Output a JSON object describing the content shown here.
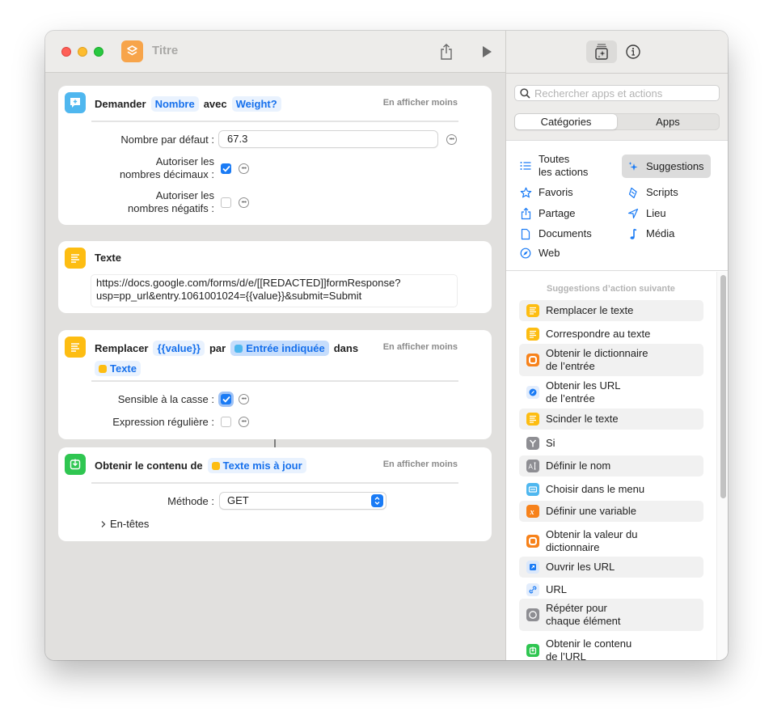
{
  "window": {
    "title": "Titre",
    "toolbar": {
      "share_icon": "share-icon",
      "run_icon": "play-icon",
      "library_icon": "action-library-icon",
      "info_icon": "info-icon"
    }
  },
  "actions": [
    {
      "id": "ask",
      "icon": "ask-input-icon",
      "color": "#4fb7ef",
      "head": {
        "verb": "Demander",
        "type_token": "Nombre",
        "joiner": "avec",
        "prompt_token": "Weight?"
      },
      "show_less": "En afficher moins",
      "fields": {
        "default_label": "Nombre par défaut :",
        "default_value": "67.3",
        "decimals_label_1": "Autoriser les",
        "decimals_label_2": "nombres décimaux :",
        "decimals_checked": true,
        "negatives_label_1": "Autoriser les",
        "negatives_label_2": "nombres négatifs :",
        "negatives_checked": false
      }
    },
    {
      "id": "text",
      "icon": "text-icon",
      "color": "#fdbd12",
      "head": {
        "verb": "Texte"
      },
      "content_line1": "https://docs.google.com/forms/d/e/[[REDACTED]]formResponse?",
      "content_line2": "usp=pp_url&entry.1061001024={{value}}&submit=Submit"
    },
    {
      "id": "replace",
      "icon": "replace-text-icon",
      "color": "#fdbd12",
      "head": {
        "verb": "Remplacer",
        "find_token": "{{value}}",
        "joiner1": "par",
        "replace_token": "Entrée indiquée",
        "joiner2": "dans",
        "target_token": "Texte"
      },
      "show_less": "En afficher moins",
      "fields": {
        "case_label": "Sensible à la casse :",
        "case_checked": true,
        "regex_label": "Expression régulière :",
        "regex_checked": false
      }
    },
    {
      "id": "get-contents",
      "icon": "download-icon",
      "color": "#2fc651",
      "head": {
        "verb": "Obtenir le contenu de",
        "url_token": "Texte mis à jour"
      },
      "show_less": "En afficher moins",
      "fields": {
        "method_label": "Méthode :",
        "method_value": "GET",
        "headers_label": "En-têtes"
      }
    }
  ],
  "library": {
    "search_placeholder": "Rechercher apps et actions",
    "segments": [
      "Catégories",
      "Apps"
    ],
    "selected_segment": "Catégories",
    "categories": [
      {
        "label_1": "Toutes",
        "label_2": "les actions",
        "icon": "list-icon"
      },
      {
        "label_1": "Suggestions",
        "icon": "sparkles-icon",
        "selected": true
      },
      {
        "label_1": "Favoris",
        "icon": "star-icon"
      },
      {
        "label_1": "Scripts",
        "icon": "scroll-icon"
      },
      {
        "label_1": "Partage",
        "icon": "share-icon"
      },
      {
        "label_1": "Lieu",
        "icon": "location-icon"
      },
      {
        "label_1": "Documents",
        "icon": "document-icon"
      },
      {
        "label_1": "Média",
        "icon": "music-note-icon"
      },
      {
        "label_1": "Web",
        "icon": "compass-icon"
      }
    ],
    "suggestions_title": "Suggestions d’action suivante",
    "suggestions": [
      {
        "label_1": "Remplacer le texte",
        "label_2": "",
        "icon": "text-icon",
        "color": "#fdbd12"
      },
      {
        "label_1": "Correspondre au texte",
        "label_2": "",
        "icon": "text-icon",
        "color": "#fdbd12"
      },
      {
        "label_1": "Obtenir le dictionnaire",
        "label_2": "de l’entrée",
        "icon": "dictionary-icon",
        "color": "#f7821b"
      },
      {
        "label_1": "Obtenir les URL",
        "label_2": "de l’entrée",
        "icon": "link-icon",
        "color": "#1a7bf5"
      },
      {
        "label_1": "Scinder le texte",
        "label_2": "",
        "icon": "text-icon",
        "color": "#fdbd12"
      },
      {
        "label_1": "Si",
        "label_2": "",
        "icon": "branch-icon",
        "color": "#8e8e93"
      },
      {
        "label_1": "Définir le nom",
        "label_2": "",
        "icon": "rename-icon",
        "color": "#8e8e93"
      },
      {
        "label_1": "Choisir dans le menu",
        "label_2": "",
        "icon": "menu-icon",
        "color": "#4fb7ef"
      },
      {
        "label_1": "Définir une variable",
        "label_2": "",
        "icon": "variable-icon",
        "color": "#f7821b"
      },
      {
        "label_1": "Obtenir la valeur du",
        "label_2": "dictionnaire",
        "icon": "dictionary-icon",
        "color": "#f7821b"
      },
      {
        "label_1": "Ouvrir les URL",
        "label_2": "",
        "icon": "open-url-icon",
        "color": "#1a7bf5"
      },
      {
        "label_1": "URL",
        "label_2": "",
        "icon": "link-icon",
        "color": "#1a7bf5"
      },
      {
        "label_1": "Répéter pour",
        "label_2": "chaque élément",
        "icon": "repeat-icon",
        "color": "#8e8e93"
      },
      {
        "label_1": "Obtenir le contenu",
        "label_2": "de l’URL",
        "icon": "download-icon",
        "color": "#2fc651"
      }
    ]
  }
}
